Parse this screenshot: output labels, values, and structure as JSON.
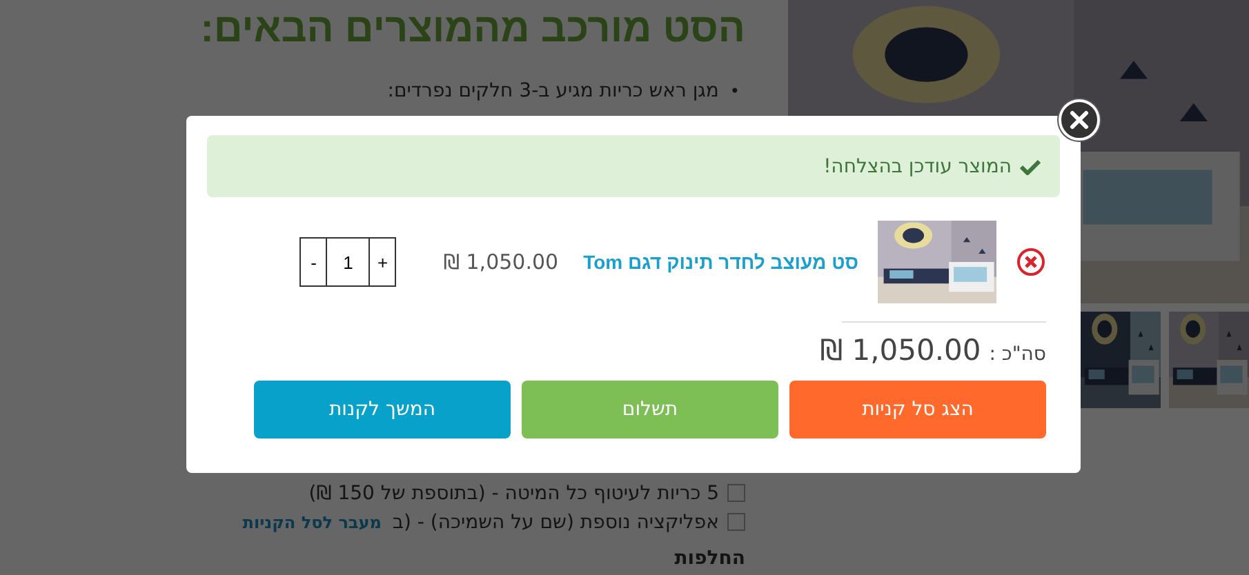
{
  "page": {
    "heading": "הסט מורכב מהמוצרים הבאים:",
    "bullets": [
      {
        "marker": "•",
        "text": "מגן ראש כריות מגיע ב-3 חלקים נפרדים:"
      }
    ],
    "options": [
      {
        "label": "5 כריות לעיטוף כל המיטה - (בתוספת של 150 ₪)",
        "checked": false
      },
      {
        "label": "אפליקציה נוספת (שם על השמיכה) - (ב",
        "checked": false
      }
    ],
    "cart_link": "מעבר לסל הקניות",
    "section_heading": "החלפות"
  },
  "modal": {
    "alert": "המוצר עודכן בהצלחה!",
    "items": [
      {
        "title": "סט מעוצב לחדר תינוק דגם Tom",
        "price": "1,050.00 ₪",
        "quantity": "1",
        "decrease": "-",
        "increase": "+"
      }
    ],
    "total_label": "סה\"כ :",
    "total_value": "1,050.00 ₪",
    "buttons": [
      {
        "label": "הצג סל קניות",
        "kind": "cart"
      },
      {
        "label": "תשלום",
        "kind": "checkout"
      },
      {
        "label": "המשך לקנות",
        "kind": "continue"
      }
    ]
  }
}
